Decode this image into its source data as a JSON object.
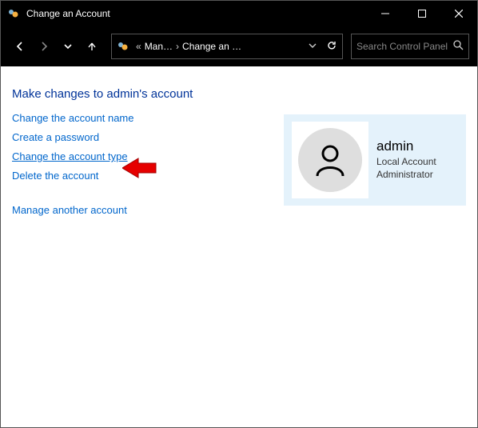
{
  "window": {
    "title": "Change an Account"
  },
  "address": {
    "prefix": "«",
    "seg1": "Man…",
    "seg2": "Change an …"
  },
  "search": {
    "placeholder": "Search Control Panel"
  },
  "page": {
    "heading": "Make changes to admin's account",
    "links": {
      "change_name": "Change the account name",
      "create_password": "Create a password",
      "change_type": "Change the account type",
      "delete_account": "Delete the account",
      "manage_another": "Manage another account"
    }
  },
  "account": {
    "name": "admin",
    "type": "Local Account",
    "role": "Administrator"
  }
}
